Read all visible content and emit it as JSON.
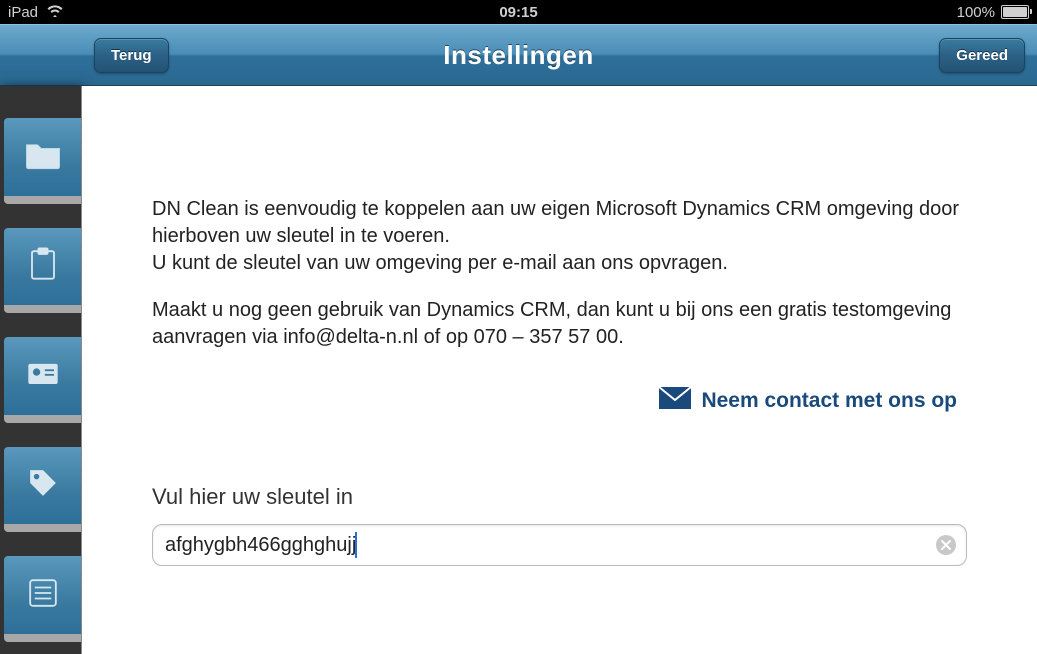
{
  "status": {
    "device": "iPad",
    "time": "09:15",
    "battery_pct": "100%"
  },
  "nav": {
    "title": "Instellingen",
    "back_label": "Terug",
    "done_label": "Gereed"
  },
  "content": {
    "paragraph1": "DN Clean is eenvoudig te koppelen aan uw eigen Microsoft Dynamics CRM omgeving door hierboven uw sleutel in te voeren.",
    "paragraph2": "U kunt de sleutel van uw omgeving per e-mail aan ons opvragen.",
    "paragraph3": "Maakt u nog geen gebruik van Dynamics CRM, dan kunt u bij ons een gratis testomgeving aanvragen via info@delta-n.nl of op 070 – 357 57 00.",
    "contact_label": "Neem contact met ons op",
    "key_field_label": "Vul hier uw sleutel in",
    "key_value": "afghygbh466gghghujj"
  }
}
